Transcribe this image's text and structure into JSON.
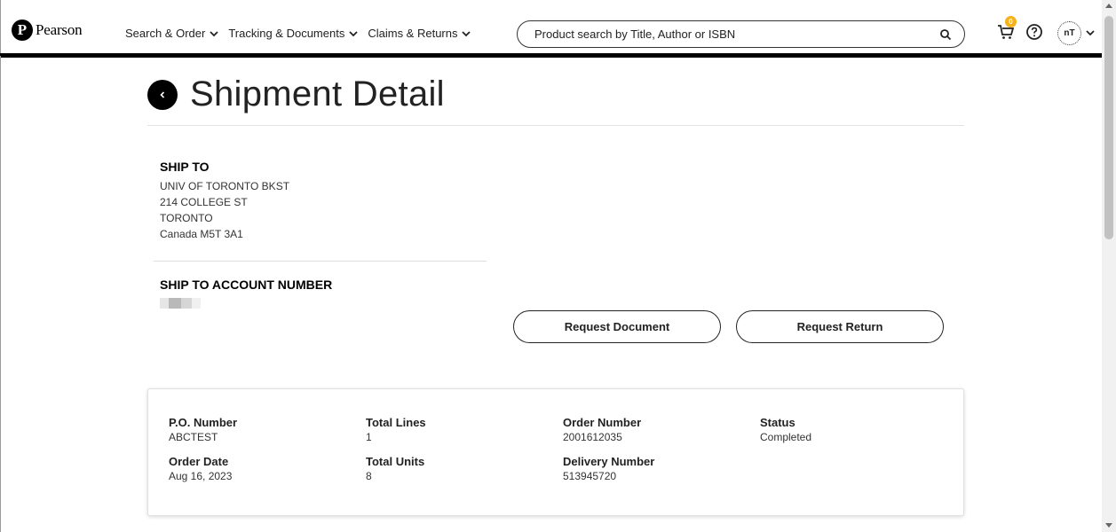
{
  "header": {
    "logo_text": "Pearson",
    "logo_mark": "P",
    "nav": [
      {
        "label": "Search & Order"
      },
      {
        "label": "Tracking & Documents"
      },
      {
        "label": "Claims & Returns"
      }
    ],
    "search_placeholder": "Product search by Title, Author or ISBN",
    "cart_count": "0",
    "avatar_initials": "nT"
  },
  "page": {
    "title": "Shipment Detail",
    "ship_to_label": "SHIP TO",
    "ship_to_lines": [
      "UNIV OF TORONTO BKST",
      "214 COLLEGE ST",
      "TORONTO",
      "Canada M5T 3A1"
    ],
    "account_label": "SHIP TO ACCOUNT NUMBER",
    "buttons": {
      "request_document": "Request Document",
      "request_return": "Request Return"
    }
  },
  "summary": {
    "po_number": {
      "label": "P.O. Number",
      "value": "ABCTEST"
    },
    "total_lines": {
      "label": "Total Lines",
      "value": "1"
    },
    "order_number": {
      "label": "Order Number",
      "value": "2001612035"
    },
    "status": {
      "label": "Status",
      "value": "Completed"
    },
    "order_date": {
      "label": "Order Date",
      "value": "Aug 16, 2023"
    },
    "total_units": {
      "label": "Total Units",
      "value": "8"
    },
    "delivery_number": {
      "label": "Delivery Number",
      "value": "513945720"
    }
  },
  "colors": {
    "accent_black": "#000000",
    "cart_badge": "#f6b21a",
    "card_border": "#e0e0e0"
  }
}
